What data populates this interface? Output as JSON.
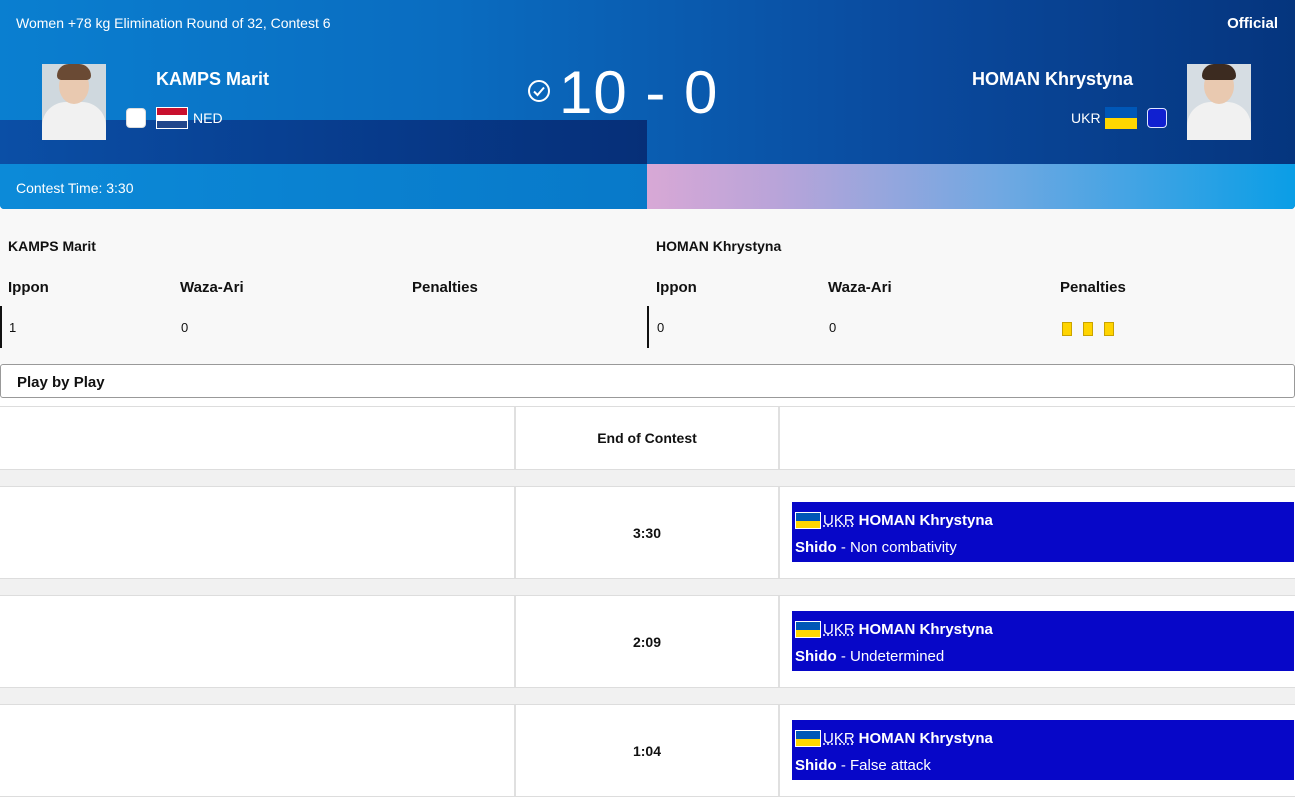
{
  "header": {
    "title": "Women +78 kg Elimination Round of 32, Contest 6",
    "status": "Official",
    "contest_time_label": "Contest Time: 3:30",
    "score": "10 - 0"
  },
  "athletes": {
    "left": {
      "name": "KAMPS Marit",
      "nation": "NED",
      "ippon": "1",
      "waza_ari": "0",
      "penalties": 0
    },
    "right": {
      "name": "HOMAN Khrystyna",
      "nation": "UKR",
      "ippon": "0",
      "waza_ari": "0",
      "penalties": 3
    }
  },
  "table_headers": {
    "ippon": "Ippon",
    "waza_ari": "Waza-Ari",
    "penalties": "Penalties"
  },
  "play_by_play": {
    "title": "Play by Play",
    "end_label": "End of Contest",
    "events": [
      {
        "time": "3:30",
        "nation": "UKR",
        "athlete": "HOMAN Khrystyna",
        "type": "Shido",
        "detail": " - Non combativity"
      },
      {
        "time": "2:09",
        "nation": "UKR",
        "athlete": "HOMAN Khrystyna",
        "type": "Shido",
        "detail": " - Undetermined"
      },
      {
        "time": "1:04",
        "nation": "UKR",
        "athlete": "HOMAN Khrystyna",
        "type": "Shido",
        "detail": " - False attack"
      }
    ]
  },
  "colors": {
    "event_bg": "#0707c8",
    "penalty_card": "#ffd400",
    "ned_red": "#c8102e",
    "ned_blue": "#21468b",
    "ukr_blue": "#0057b7",
    "ukr_yellow": "#ffd700"
  }
}
